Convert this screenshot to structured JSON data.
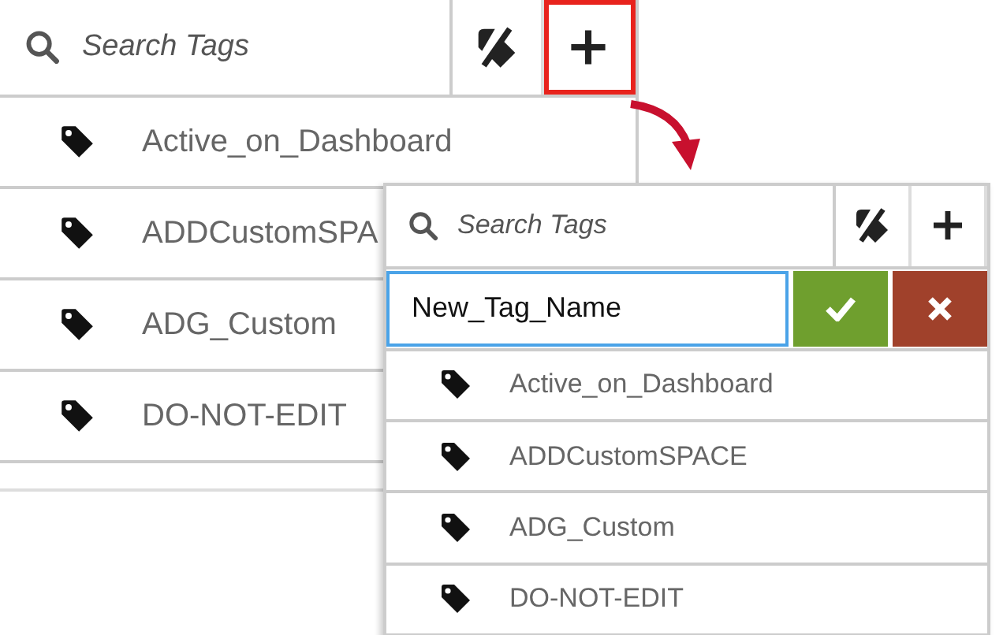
{
  "back_panel": {
    "search": {
      "placeholder": "Search Tags"
    },
    "add_button": {
      "highlighted": true
    },
    "tags": [
      {
        "name": "Active_on_Dashboard"
      },
      {
        "name": "ADDCustomSPA"
      },
      {
        "name": "ADG_Custom"
      },
      {
        "name": "DO-NOT-EDIT"
      }
    ]
  },
  "front_panel": {
    "search": {
      "placeholder": "Search Tags"
    },
    "add_button": {
      "highlighted": false
    },
    "new_tag": {
      "value": "New_Tag_Name"
    },
    "tags": [
      {
        "name": "Active_on_Dashboard"
      },
      {
        "name": "ADDCustomSPACE"
      },
      {
        "name": "ADG_Custom"
      },
      {
        "name": "DO-NOT-EDIT"
      }
    ]
  }
}
